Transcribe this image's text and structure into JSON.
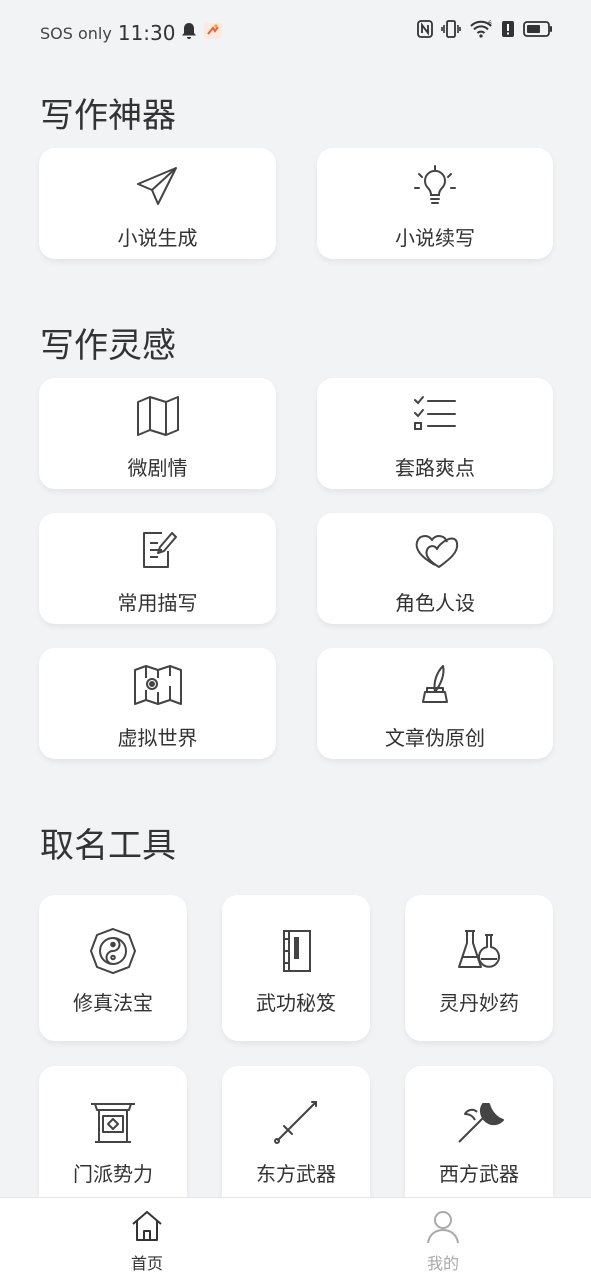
{
  "status": {
    "sos": "SOS only",
    "time": "11:30"
  },
  "sections": {
    "writing_tools": "写作神器",
    "inspiration": "写作灵感",
    "naming": "取名工具"
  },
  "writing_tools": {
    "novel_generate": "小说生成",
    "novel_continue": "小说续写"
  },
  "inspiration": {
    "micro_plot": "微剧情",
    "routines": "套路爽点",
    "descriptions": "常用描写",
    "characters": "角色人设",
    "virtual_world": "虚拟世界",
    "pseudo_original": "文章伪原创"
  },
  "naming": {
    "treasure": "修真法宝",
    "martial_arts": "武功秘笈",
    "elixir": "灵丹妙药",
    "sect": "门派势力",
    "eastern_weapon": "东方武器",
    "western_weapon": "西方武器"
  },
  "nav": {
    "home": "首页",
    "mine": "我的"
  },
  "colors": {
    "background": "#f2f3f5",
    "card": "#ffffff",
    "nav_active": "#333333",
    "nav_inactive": "#aaaaaa"
  }
}
